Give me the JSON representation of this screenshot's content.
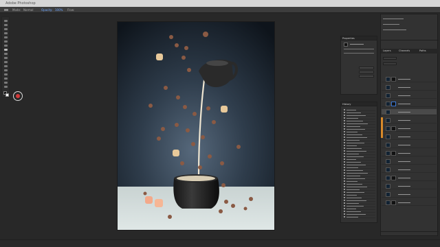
{
  "app": {
    "title": "Adobe Photoshop"
  },
  "options_bar": {
    "items": [
      "Mode:",
      "Normal",
      "Opacity:",
      "100%",
      "Flow:"
    ]
  },
  "layers_panel": {
    "tabs": [
      "Layers",
      "Channels",
      "Paths"
    ]
  },
  "history_panel": {
    "tabs": [
      "History"
    ]
  },
  "properties_panel": {
    "tabs": [
      "Properties"
    ]
  },
  "colors": {
    "accent": "#3a78d8",
    "brush_cursor": "#d23a3a"
  }
}
